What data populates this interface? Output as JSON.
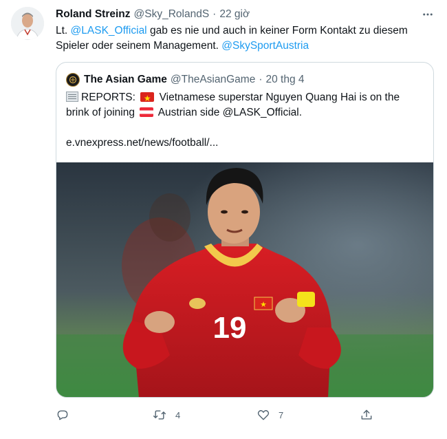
{
  "tweet": {
    "author_name": "Roland Streinz",
    "author_handle": "@Sky_RolandS",
    "separator": "·",
    "time": "22 giờ",
    "text_prefix": "Lt. ",
    "mention_1": "@LASK_Official",
    "text_middle": " gab es nie und auch in keiner Form Kontakt zu diesem Spieler oder seinem Management. ",
    "mention_2": "@SkySportAustria"
  },
  "quoted_tweet": {
    "author_name": "The Asian Game",
    "author_handle": "@TheAsianGame",
    "separator": "·",
    "time": "20 thg 4",
    "text_part1": "REPORTS: ",
    "text_part2": " Vietnamese superstar Nguyen Quang Hai is on the",
    "text_part3": "brink of joining ",
    "text_part4": " Austrian side @LASK_Official.",
    "link_text": "e.vnexpress.net/news/football/...",
    "image": {
      "jersey_number": "19",
      "description": "footballer in red jersey celebrating"
    }
  },
  "actions": {
    "reply_count": "",
    "retweet_count": "4",
    "like_count": "7"
  },
  "colors": {
    "link": "#1d9bf0",
    "secondary_text": "#536471",
    "border": "#cfd9de",
    "jersey_red": "#c8171e"
  },
  "icons": {
    "reply": "reply-icon",
    "retweet": "retweet-icon",
    "like": "heart-icon",
    "share": "share-icon",
    "more": "more-icon"
  }
}
